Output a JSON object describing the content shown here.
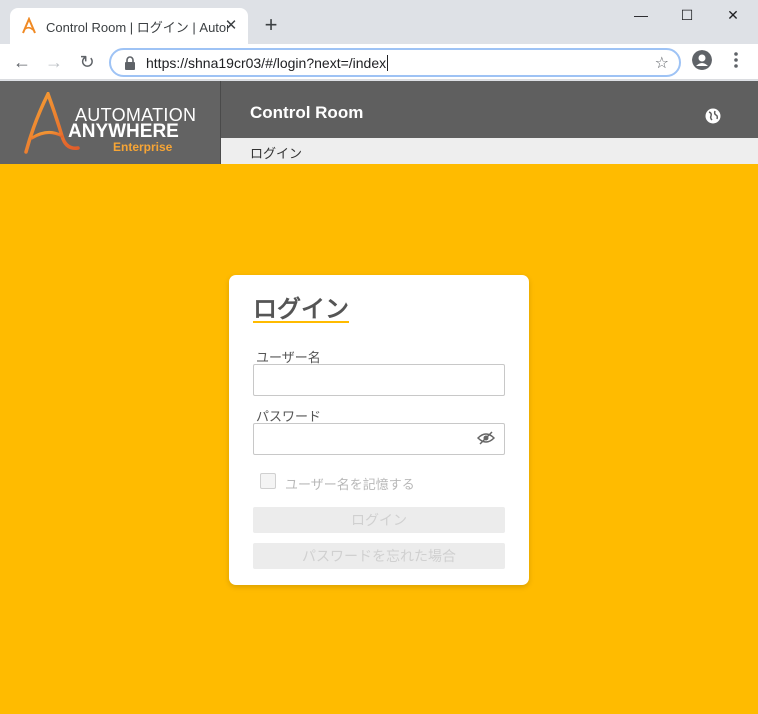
{
  "browser": {
    "tab_title": "Control Room | ログイン | Automat",
    "url": "https://shna19cr03/#/login?next=/index"
  },
  "app": {
    "logo_line1": "AUTOMATION",
    "logo_line2": "ANYWHERE",
    "logo_line3": "Enterprise",
    "title": "Control Room",
    "breadcrumb": "ログイン"
  },
  "login": {
    "title": "ログイン",
    "username_label": "ユーザー名",
    "username_value": "",
    "password_label": "パスワード",
    "password_value": "",
    "remember_label": "ユーザー名を記憶する",
    "remember_checked": false,
    "login_button": "ログイン",
    "forgot_button": "パスワードを忘れた場合"
  },
  "colors": {
    "accent": "#ffbb00",
    "header": "#5f5f5f",
    "logo_orange": "#f7a535"
  }
}
